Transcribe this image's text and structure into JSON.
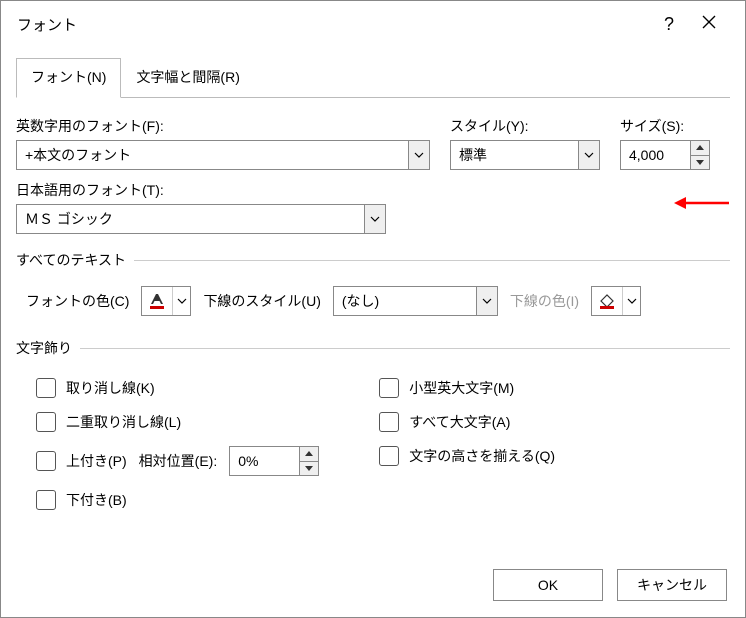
{
  "title": "フォント",
  "tabs": {
    "font": "フォント(N)",
    "spacing": "文字幅と間隔(R)"
  },
  "labels": {
    "western_font": "英数字用のフォント(F):",
    "style": "スタイル(Y):",
    "size": "サイズ(S):",
    "asian_font": "日本語用のフォント(T):",
    "all_text": "すべてのテキスト",
    "font_color": "フォントの色(C)",
    "underline_style": "下線のスタイル(U)",
    "underline_color": "下線の色(I)",
    "decorations": "文字飾り",
    "relpos": "相対位置(E):"
  },
  "values": {
    "western_font": "+本文のフォント",
    "style": "標準",
    "size": "4,000",
    "asian_font": "ＭＳ ゴシック",
    "underline_style": "(なし)",
    "relpos": "0%"
  },
  "checks": {
    "strike": "取り消し線(K)",
    "dstrike": "二重取り消し線(L)",
    "super": "上付き(P)",
    "sub": "下付き(B)",
    "smallcaps": "小型英大文字(M)",
    "allcaps": "すべて大文字(A)",
    "equalize": "文字の高さを揃える(Q)"
  },
  "buttons": {
    "ok": "OK",
    "cancel": "キャンセル"
  }
}
